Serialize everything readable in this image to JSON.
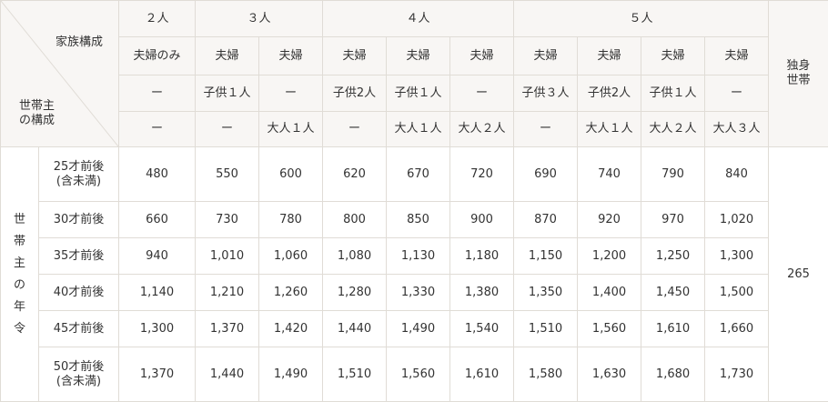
{
  "corner": {
    "top_label": "家族構成",
    "bottom_line1": "世帯主",
    "bottom_line2": "の構成"
  },
  "groups": [
    "２人",
    "３人",
    "４人",
    "５人"
  ],
  "single": {
    "line1": "独身",
    "line2": "世帯"
  },
  "row_couple": [
    "夫婦のみ",
    "夫婦",
    "夫婦",
    "夫婦",
    "夫婦",
    "夫婦",
    "夫婦",
    "夫婦",
    "夫婦",
    "夫婦"
  ],
  "row_children": [
    "ー",
    "子供１人",
    "ー",
    "子供2人",
    "子供１人",
    "ー",
    "子供３人",
    "子供2人",
    "子供１人",
    "ー"
  ],
  "row_adults": [
    "ー",
    "ー",
    "大人１人",
    "ー",
    "大人１人",
    "大人２人",
    "ー",
    "大人１人",
    "大人２人",
    "大人３人"
  ],
  "side_label": "世帯主の年令",
  "rows": [
    {
      "age_line1": "25才前後",
      "age_line2": "(含未満)",
      "values": [
        "480",
        "550",
        "600",
        "620",
        "670",
        "720",
        "690",
        "740",
        "790",
        "840"
      ]
    },
    {
      "age_line1": "30才前後",
      "age_line2": "",
      "values": [
        "660",
        "730",
        "780",
        "800",
        "850",
        "900",
        "870",
        "920",
        "970",
        "1,020"
      ]
    },
    {
      "age_line1": "35才前後",
      "age_line2": "",
      "values": [
        "940",
        "1,010",
        "1,060",
        "1,080",
        "1,130",
        "1,180",
        "1,150",
        "1,200",
        "1,250",
        "1,300"
      ]
    },
    {
      "age_line1": "40才前後",
      "age_line2": "",
      "values": [
        "1,140",
        "1,210",
        "1,260",
        "1,280",
        "1,330",
        "1,380",
        "1,350",
        "1,400",
        "1,450",
        "1,500"
      ]
    },
    {
      "age_line1": "45才前後",
      "age_line2": "",
      "values": [
        "1,300",
        "1,370",
        "1,420",
        "1,440",
        "1,490",
        "1,540",
        "1,510",
        "1,560",
        "1,610",
        "1,660"
      ]
    },
    {
      "age_line1": "50才前後",
      "age_line2": "(含未満)",
      "values": [
        "1,370",
        "1,440",
        "1,490",
        "1,510",
        "1,560",
        "1,610",
        "1,580",
        "1,630",
        "1,680",
        "1,730"
      ]
    }
  ],
  "single_value": "265"
}
